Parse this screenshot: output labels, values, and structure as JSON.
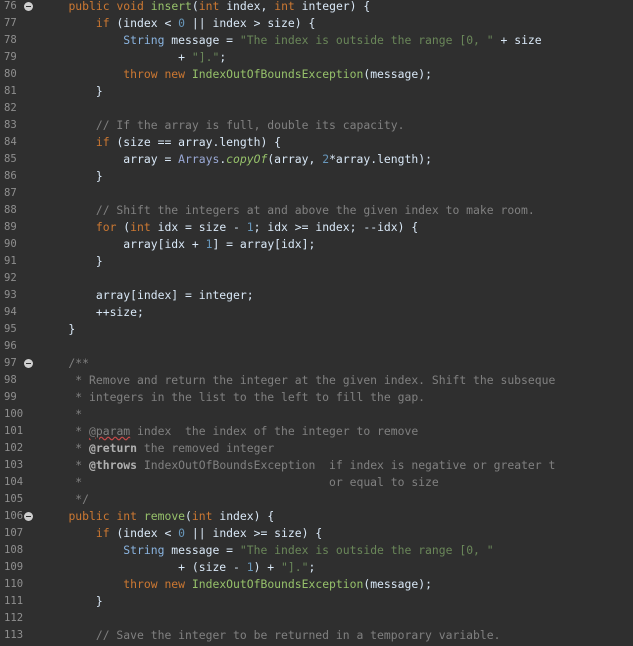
{
  "editor": {
    "lines": [
      {
        "num": "76",
        "fold": true,
        "tokens": [
          {
            "t": "    ",
            "c": "plain"
          },
          {
            "t": "public",
            "c": "kw"
          },
          {
            "t": " ",
            "c": "plain"
          },
          {
            "t": "void",
            "c": "kw"
          },
          {
            "t": " ",
            "c": "plain"
          },
          {
            "t": "insert",
            "c": "method"
          },
          {
            "t": "(",
            "c": "plain"
          },
          {
            "t": "int",
            "c": "kw"
          },
          {
            "t": " index, ",
            "c": "plain"
          },
          {
            "t": "int",
            "c": "kw"
          },
          {
            "t": " integer) {",
            "c": "plain"
          }
        ]
      },
      {
        "num": "77",
        "tokens": [
          {
            "t": "        ",
            "c": "plain"
          },
          {
            "t": "if",
            "c": "kw"
          },
          {
            "t": " (index < ",
            "c": "plain"
          },
          {
            "t": "0",
            "c": "num"
          },
          {
            "t": " || index > size) {",
            "c": "plain"
          }
        ]
      },
      {
        "num": "78",
        "tokens": [
          {
            "t": "            ",
            "c": "plain"
          },
          {
            "t": "String",
            "c": "type"
          },
          {
            "t": " message = ",
            "c": "plain"
          },
          {
            "t": "\"The index is outside the range [0, \"",
            "c": "str"
          },
          {
            "t": " + size",
            "c": "plain"
          }
        ]
      },
      {
        "num": "79",
        "tokens": [
          {
            "t": "                    + ",
            "c": "plain"
          },
          {
            "t": "\"].\"",
            "c": "str"
          },
          {
            "t": ";",
            "c": "plain"
          }
        ]
      },
      {
        "num": "80",
        "tokens": [
          {
            "t": "            ",
            "c": "plain"
          },
          {
            "t": "throw",
            "c": "kw"
          },
          {
            "t": " ",
            "c": "plain"
          },
          {
            "t": "new",
            "c": "kw"
          },
          {
            "t": " ",
            "c": "plain"
          },
          {
            "t": "IndexOutOfBoundsException",
            "c": "method"
          },
          {
            "t": "(message);",
            "c": "plain"
          }
        ]
      },
      {
        "num": "81",
        "tokens": [
          {
            "t": "        }",
            "c": "plain"
          }
        ]
      },
      {
        "num": "82",
        "tokens": []
      },
      {
        "num": "83",
        "tokens": [
          {
            "t": "        // If the array is full, double its capacity.",
            "c": "comment"
          }
        ]
      },
      {
        "num": "84",
        "tokens": [
          {
            "t": "        ",
            "c": "plain"
          },
          {
            "t": "if",
            "c": "kw"
          },
          {
            "t": " (size == array.length) {",
            "c": "plain"
          }
        ]
      },
      {
        "num": "85",
        "tokens": [
          {
            "t": "            array = ",
            "c": "plain"
          },
          {
            "t": "Arrays",
            "c": "class"
          },
          {
            "t": ".",
            "c": "plain"
          },
          {
            "t": "copyOf",
            "c": "italic"
          },
          {
            "t": "(array, ",
            "c": "plain"
          },
          {
            "t": "2",
            "c": "num"
          },
          {
            "t": "*array.length);",
            "c": "plain"
          }
        ]
      },
      {
        "num": "86",
        "tokens": [
          {
            "t": "        }",
            "c": "plain"
          }
        ]
      },
      {
        "num": "87",
        "tokens": []
      },
      {
        "num": "88",
        "tokens": [
          {
            "t": "        // Shift the integers at and above the given index to make room.",
            "c": "comment"
          }
        ]
      },
      {
        "num": "89",
        "tokens": [
          {
            "t": "        ",
            "c": "plain"
          },
          {
            "t": "for",
            "c": "kw"
          },
          {
            "t": " (",
            "c": "plain"
          },
          {
            "t": "int",
            "c": "kw"
          },
          {
            "t": " idx = size - ",
            "c": "plain"
          },
          {
            "t": "1",
            "c": "num"
          },
          {
            "t": "; idx >= index; --idx) {",
            "c": "plain"
          }
        ]
      },
      {
        "num": "90",
        "tokens": [
          {
            "t": "            array[idx + ",
            "c": "plain"
          },
          {
            "t": "1",
            "c": "num"
          },
          {
            "t": "] = array[idx];",
            "c": "plain"
          }
        ]
      },
      {
        "num": "91",
        "tokens": [
          {
            "t": "        }",
            "c": "plain"
          }
        ]
      },
      {
        "num": "92",
        "tokens": []
      },
      {
        "num": "93",
        "tokens": [
          {
            "t": "        array[index] = integer;",
            "c": "plain"
          }
        ]
      },
      {
        "num": "94",
        "tokens": [
          {
            "t": "        ++size;",
            "c": "plain"
          }
        ]
      },
      {
        "num": "95",
        "tokens": [
          {
            "t": "    }",
            "c": "plain"
          }
        ]
      },
      {
        "num": "96",
        "tokens": []
      },
      {
        "num": "97",
        "fold": true,
        "tokens": [
          {
            "t": "    /**",
            "c": "doc"
          }
        ]
      },
      {
        "num": "98",
        "tokens": [
          {
            "t": "     * Remove and return the integer at the given index. Shift the subseque",
            "c": "doc"
          }
        ]
      },
      {
        "num": "99",
        "tokens": [
          {
            "t": "     * integers in the list to the left to fill the gap.",
            "c": "doc"
          }
        ]
      },
      {
        "num": "100",
        "tokens": [
          {
            "t": "     *",
            "c": "doc"
          }
        ]
      },
      {
        "num": "101",
        "tokens": [
          {
            "t": "     * ",
            "c": "doc"
          },
          {
            "t": "@param",
            "c": "err"
          },
          {
            "t": " index  the index of the integer to remove",
            "c": "doc"
          }
        ]
      },
      {
        "num": "102",
        "tokens": [
          {
            "t": "     * ",
            "c": "doc"
          },
          {
            "t": "@return",
            "c": "doctag"
          },
          {
            "t": " the removed integer",
            "c": "doc"
          }
        ]
      },
      {
        "num": "103",
        "tokens": [
          {
            "t": "     * ",
            "c": "doc"
          },
          {
            "t": "@throws",
            "c": "doctag"
          },
          {
            "t": " IndexOutOfBoundsException  if index is negative or greater t",
            "c": "doc"
          }
        ]
      },
      {
        "num": "104",
        "tokens": [
          {
            "t": "     *                                    or equal to size",
            "c": "doc"
          }
        ]
      },
      {
        "num": "105",
        "tokens": [
          {
            "t": "     */",
            "c": "doc"
          }
        ]
      },
      {
        "num": "106",
        "fold": true,
        "tokens": [
          {
            "t": "    ",
            "c": "plain"
          },
          {
            "t": "public",
            "c": "kw"
          },
          {
            "t": " ",
            "c": "plain"
          },
          {
            "t": "int",
            "c": "kw"
          },
          {
            "t": " ",
            "c": "plain"
          },
          {
            "t": "remove",
            "c": "method"
          },
          {
            "t": "(",
            "c": "plain"
          },
          {
            "t": "int",
            "c": "kw"
          },
          {
            "t": " index) {",
            "c": "plain"
          }
        ]
      },
      {
        "num": "107",
        "tokens": [
          {
            "t": "        ",
            "c": "plain"
          },
          {
            "t": "if",
            "c": "kw"
          },
          {
            "t": " (index < ",
            "c": "plain"
          },
          {
            "t": "0",
            "c": "num"
          },
          {
            "t": " || index >= size) {",
            "c": "plain"
          }
        ]
      },
      {
        "num": "108",
        "tokens": [
          {
            "t": "            ",
            "c": "plain"
          },
          {
            "t": "String",
            "c": "type"
          },
          {
            "t": " message = ",
            "c": "plain"
          },
          {
            "t": "\"The index is outside the range [0, \"",
            "c": "str"
          }
        ]
      },
      {
        "num": "109",
        "tokens": [
          {
            "t": "                    + (size - ",
            "c": "plain"
          },
          {
            "t": "1",
            "c": "num"
          },
          {
            "t": ") + ",
            "c": "plain"
          },
          {
            "t": "\"].\"",
            "c": "str"
          },
          {
            "t": ";",
            "c": "plain"
          }
        ]
      },
      {
        "num": "110",
        "tokens": [
          {
            "t": "            ",
            "c": "plain"
          },
          {
            "t": "throw",
            "c": "kw"
          },
          {
            "t": " ",
            "c": "plain"
          },
          {
            "t": "new",
            "c": "kw"
          },
          {
            "t": " ",
            "c": "plain"
          },
          {
            "t": "IndexOutOfBoundsException",
            "c": "method"
          },
          {
            "t": "(message);",
            "c": "plain"
          }
        ]
      },
      {
        "num": "111",
        "tokens": [
          {
            "t": "        }",
            "c": "plain"
          }
        ]
      },
      {
        "num": "112",
        "tokens": []
      },
      {
        "num": "113",
        "tokens": [
          {
            "t": "        // Save the integer to be returned in a temporary variable.",
            "c": "comment"
          }
        ]
      }
    ]
  },
  "colors": {
    "background": "#2f2f2f",
    "line_number": "#8f8f8f",
    "keyword": "#cc7832",
    "plain": "#d9e8f7",
    "number": "#6897bb",
    "string": "#6a8759",
    "method": "#96c16a",
    "comment": "#808080"
  }
}
